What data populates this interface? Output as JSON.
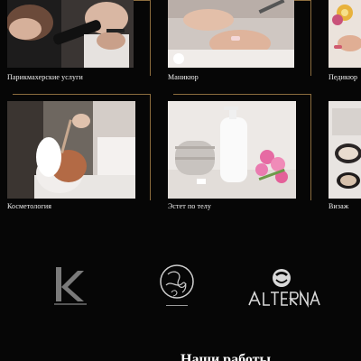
{
  "services": [
    {
      "label": "Парикмахерские услуги"
    },
    {
      "label": "Маникюр"
    },
    {
      "label": "Педикюр"
    },
    {
      "label": "Косметология"
    },
    {
      "label": "Эстет по телу"
    },
    {
      "label": "Визаж"
    }
  ],
  "brands": [
    {
      "name": "KEVIN.MURPHY",
      "logo_letter": "k",
      "icon": "kevin-murphy-logo"
    },
    {
      "name": "ORIBE",
      "icon": "oribe-logo"
    },
    {
      "name": "ALTERNA",
      "icon": "alterna-logo"
    }
  ],
  "section_heading": "Наши работы",
  "colors": {
    "background": "#060606",
    "frame_accent": "#8c6d3e",
    "text": "#ffffff"
  }
}
